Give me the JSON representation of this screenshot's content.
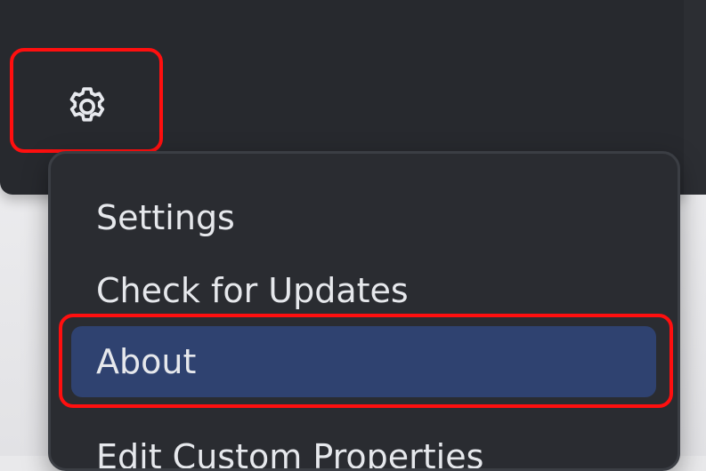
{
  "toolbar": {
    "settings_icon": "gear-icon"
  },
  "menu": {
    "items": [
      {
        "label": "Settings"
      },
      {
        "label": "Check for Updates"
      },
      {
        "label": "About",
        "selected": true
      },
      {
        "label": "Edit Custom Properties"
      }
    ]
  },
  "colors": {
    "window_bg": "#27292e",
    "menu_bg": "#2a2c31",
    "selected_bg": "#2f4270",
    "highlight": "#ff0f0f",
    "text": "#e6e8ec"
  }
}
